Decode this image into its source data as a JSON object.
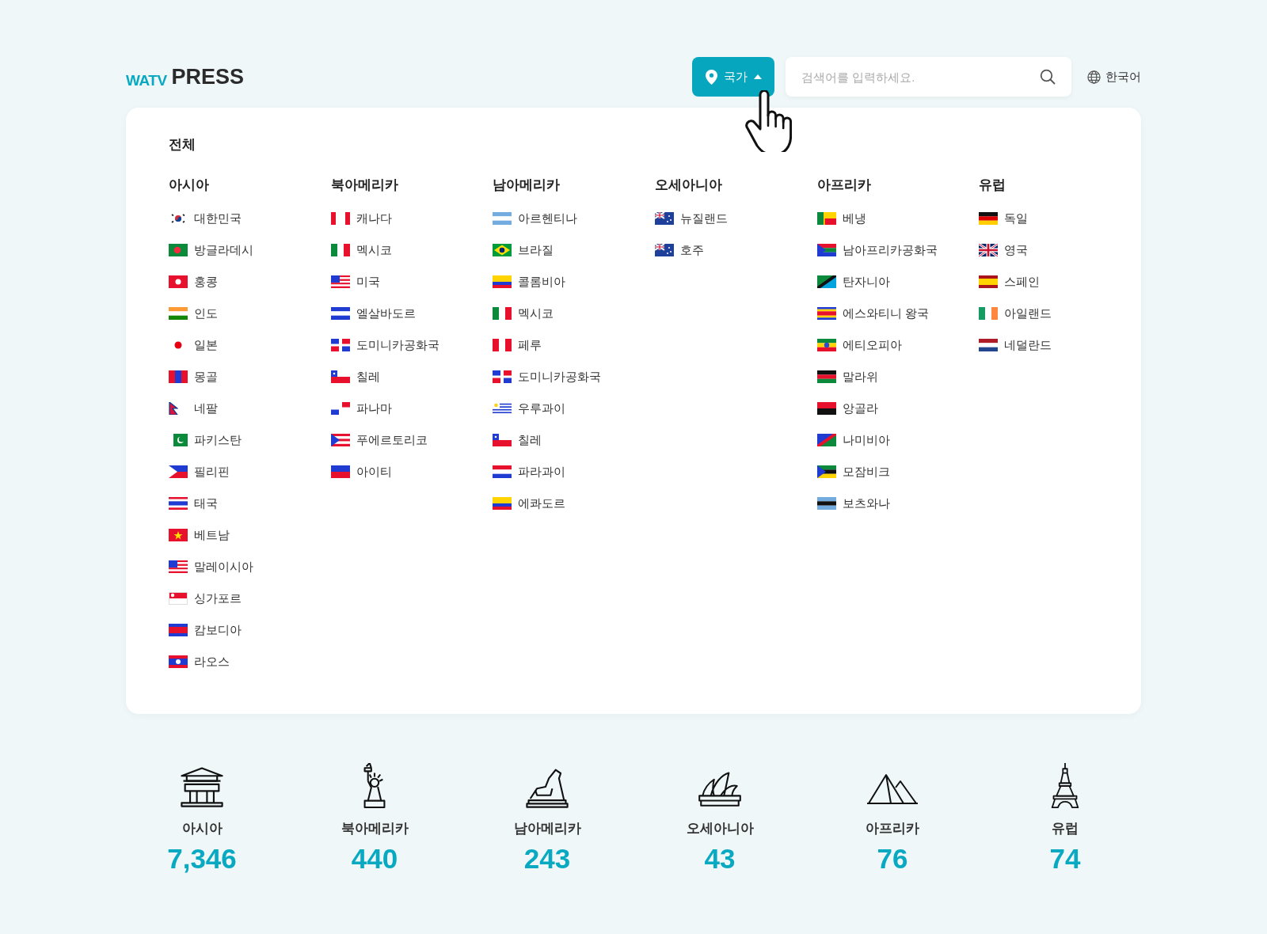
{
  "header": {
    "logo_prefix": "WATV",
    "logo_main": "PRESS",
    "country_button": {
      "label": "국가",
      "expanded": true
    },
    "search": {
      "placeholder": "검색어를 입력하세요."
    },
    "language": "한국어"
  },
  "dropdown": {
    "all_label": "전체",
    "regions": [
      {
        "name": "아시아",
        "countries": [
          "대한민국",
          "방글라데시",
          "홍콩",
          "인도",
          "일본",
          "몽골",
          "네팔",
          "파키스탄",
          "필리핀",
          "태국",
          "베트남",
          "말레이시아",
          "싱가포르",
          "캄보디아",
          "라오스"
        ]
      },
      {
        "name": "북아메리카",
        "countries": [
          "캐나다",
          "멕시코",
          "미국",
          "엘살바도르",
          "도미니카공화국",
          "칠레",
          "파나마",
          "푸에르토리코",
          "아이티"
        ]
      },
      {
        "name": "남아메리카",
        "countries": [
          "아르헨티나",
          "브라질",
          "콜롬비아",
          "멕시코",
          "페루",
          "도미니카공화국",
          "우루과이",
          "칠레",
          "파라과이",
          "에콰도르"
        ]
      },
      {
        "name": "오세아니아",
        "countries": [
          "뉴질랜드",
          "호주"
        ]
      },
      {
        "name": "아프리카",
        "countries": [
          "베냉",
          "남아프리카공화국",
          "탄자니아",
          "에스와티니 왕국",
          "에티오피아",
          "말라위",
          "앙골라",
          "나미비아",
          "모잠비크",
          "보츠와나"
        ]
      },
      {
        "name": "유럽",
        "countries": [
          "독일",
          "영국",
          "스페인",
          "아일랜드",
          "네덜란드"
        ]
      }
    ]
  },
  "stats": [
    {
      "region": "아시아",
      "count": "7,346"
    },
    {
      "region": "북아메리카",
      "count": "440"
    },
    {
      "region": "남아메리카",
      "count": "243"
    },
    {
      "region": "오세아니아",
      "count": "43"
    },
    {
      "region": "아프리카",
      "count": "76"
    },
    {
      "region": "유럽",
      "count": "74"
    }
  ]
}
